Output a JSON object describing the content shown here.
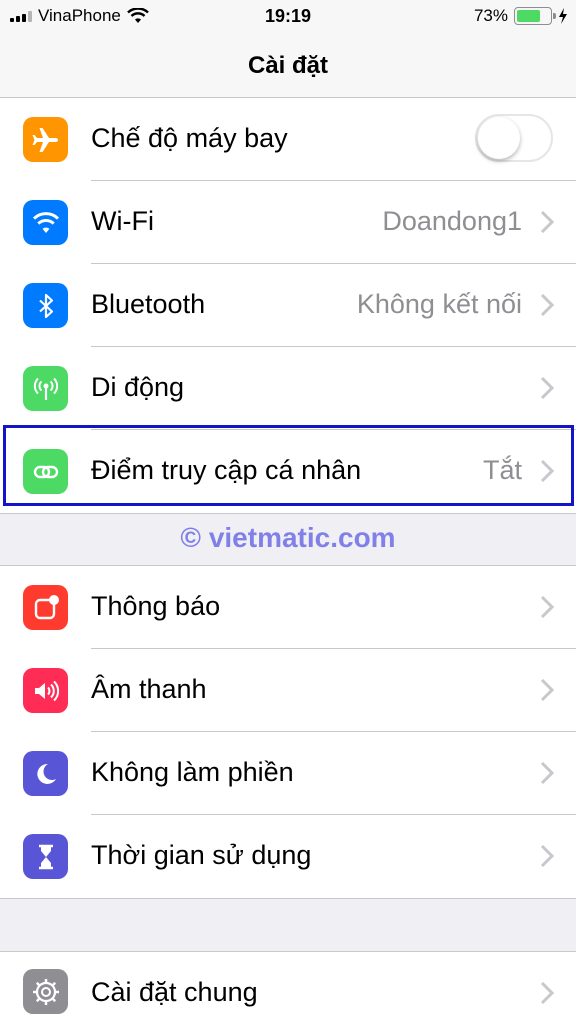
{
  "status_bar": {
    "carrier": "VinaPhone",
    "time": "19:19",
    "battery_percent": "73%",
    "battery_level": 0.73
  },
  "nav": {
    "title": "Cài đặt"
  },
  "group1": [
    {
      "label": "Chế độ máy bay",
      "value": "",
      "icon": "airplane-icon",
      "color": "#ff9500",
      "toggle": false
    },
    {
      "label": "Wi-Fi",
      "value": "Doandong1",
      "icon": "wifi-icon",
      "color": "#007aff"
    },
    {
      "label": "Bluetooth",
      "value": "Không kết nối",
      "icon": "bluetooth-icon",
      "color": "#007aff"
    },
    {
      "label": "Di động",
      "value": "",
      "icon": "cellular-icon",
      "color": "#4cd964"
    },
    {
      "label": "Điểm truy cập cá nhân",
      "value": "Tắt",
      "icon": "hotspot-icon",
      "color": "#4cd964"
    }
  ],
  "watermark": "© vietmatic.com",
  "group2": [
    {
      "label": "Thông báo",
      "icon": "notifications-icon",
      "color": "#ff3b30"
    },
    {
      "label": "Âm thanh",
      "icon": "sound-icon",
      "color": "#ff2d55"
    },
    {
      "label": "Không làm phiền",
      "icon": "moon-icon",
      "color": "#5856d6"
    },
    {
      "label": "Thời gian sử dụng",
      "icon": "hourglass-icon",
      "color": "#5856d6"
    }
  ],
  "group3": [
    {
      "label": "Cài đặt chung",
      "icon": "gear-icon",
      "color": "#8e8e93"
    }
  ],
  "highlight_color": "#1313c8"
}
